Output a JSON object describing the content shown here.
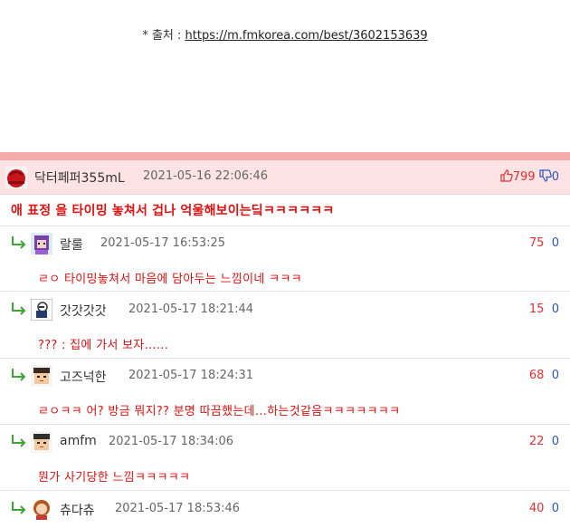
{
  "source": {
    "prefix": "* 출처 : ",
    "link": "https://m.fmkorea.com/best/3602153639"
  },
  "best_comment": {
    "nickname": "닥터페퍼355mL",
    "date": "2021-05-16 22:06:46",
    "upvotes": "799",
    "downvotes": "0",
    "body": "애 표정 을 타이밍 놓쳐서 겁나 억울해보이는딬ㅋㅋㅋㅋㅋㅋ"
  },
  "replies": [
    {
      "nickname": "랄룰",
      "date": "2021-05-17 16:53:25",
      "upvotes": "75",
      "downvotes": "0",
      "body": "ㄹㅇ 타이밍놓쳐서 마음에 담아두는 느낌이네 ㅋㅋㅋ"
    },
    {
      "nickname": "갓갓갓갓",
      "date": "2021-05-17 18:21:44",
      "upvotes": "15",
      "downvotes": "0",
      "body": "??? : 집에 가서 보자......"
    },
    {
      "nickname": "고즈넉한",
      "date": "2021-05-17 18:24:31",
      "upvotes": "68",
      "downvotes": "0",
      "body": "ㄹㅇㅋㅋ 어? 방금 뭐지?? 분명 따끔했는데...하는것같음ㅋㅋㅋㅋㅋㅋㅋ"
    },
    {
      "nickname": "amfm",
      "date": "2021-05-17 18:34:06",
      "upvotes": "22",
      "downvotes": "0",
      "body": "뭔가 사기당한 느낌ㅋㅋㅋㅋㅋ"
    },
    {
      "nickname": "츄다츄",
      "date": "2021-05-17 18:53:46",
      "upvotes": "40",
      "downvotes": "0",
      "body": ""
    }
  ],
  "icons": {
    "reply": "reply-arrow-icon",
    "up": "thumbs-up-icon",
    "down": "thumbs-down-icon"
  },
  "colors": {
    "upvote": "#e03030",
    "downvote": "#2a55c8",
    "body_text": "#e01010",
    "best_bg": "#fde3e3",
    "divider": "#f6a9a9"
  }
}
